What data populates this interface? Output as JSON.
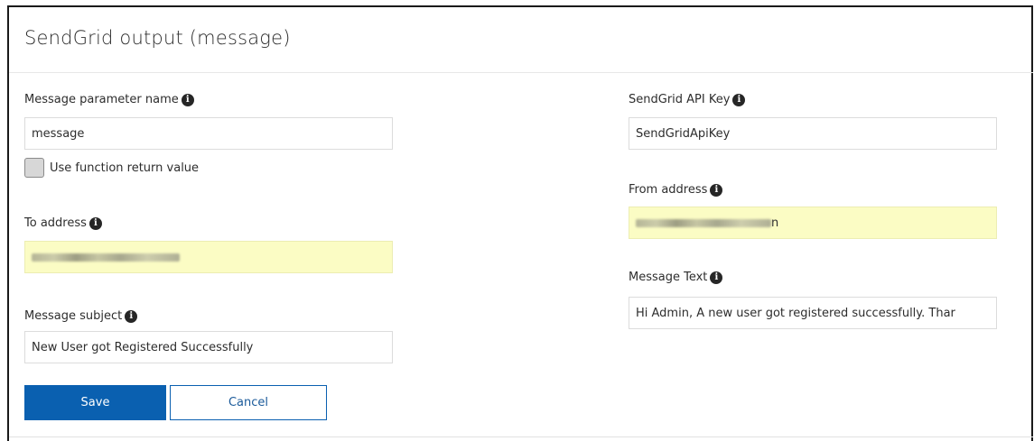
{
  "panel": {
    "title": "SendGrid output (message)"
  },
  "left": {
    "message_param": {
      "label": "Message parameter name",
      "value": "message"
    },
    "use_return": {
      "label": "Use function return value",
      "checked": false
    },
    "to_address": {
      "label": "To address",
      "value_obscured": true
    },
    "subject": {
      "label": "Message subject",
      "value": "New User got Registered Successfully"
    }
  },
  "right": {
    "api_key": {
      "label": "SendGrid API Key",
      "value": "SendGridApiKey"
    },
    "from_address": {
      "label": "From address",
      "visible_suffix": "n",
      "value_obscured": true
    },
    "message_text": {
      "label": "Message Text",
      "value": "Hi Admin, A new user got registered successfully. Thar"
    }
  },
  "buttons": {
    "save": "Save",
    "cancel": "Cancel"
  },
  "colors": {
    "primary": "#0a60b0",
    "highlight": "#fbfcc4",
    "info_icon": "#262626"
  },
  "icons": {
    "info": "info-circle-icon"
  }
}
